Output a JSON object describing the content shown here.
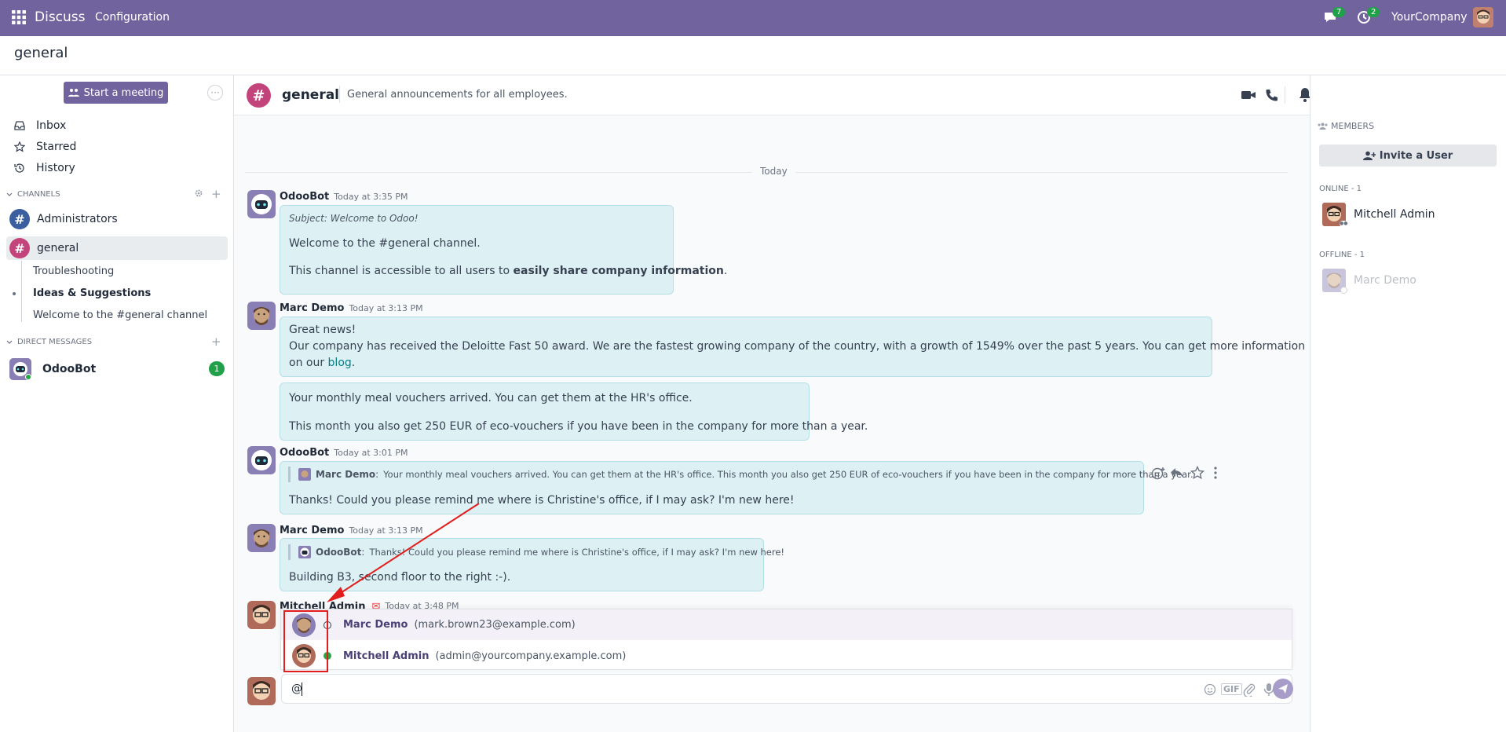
{
  "topbar": {
    "app_name": "Discuss",
    "menu_configuration": "Configuration",
    "messages_count": "7",
    "activities_count": "2",
    "company": "YourCompany"
  },
  "breadcrumb": {
    "title": "general"
  },
  "sidebar": {
    "start_meeting": "Start a meeting",
    "nav": [
      {
        "label": "Inbox",
        "icon": "inbox-icon"
      },
      {
        "label": "Starred",
        "icon": "star-icon"
      },
      {
        "label": "History",
        "icon": "history-icon"
      }
    ],
    "channels_header": "CHANNELS",
    "channels": [
      {
        "label": "Administrators",
        "color": "#3b5ea0"
      },
      {
        "label": "general",
        "color": "#c2447a"
      }
    ],
    "subchannels": [
      "Troubleshooting",
      "Ideas & Suggestions",
      "Welcome to the #general channel"
    ],
    "dm_header": "DIRECT MESSAGES",
    "dm": {
      "label": "OdooBot",
      "unread": "1"
    }
  },
  "channel": {
    "name": "general",
    "description": "General announcements for all employees."
  },
  "thread": {
    "date_separator": "Today",
    "messages": [
      {
        "author": "OdooBot",
        "time": "Today at 3:35 PM",
        "subject": "Subject: Welcome to Odoo!",
        "line1": "Welcome to the #general channel.",
        "line2_pre": "This channel is accessible to all users to ",
        "line2_bold": "easily share company information",
        "line2_post": "."
      },
      {
        "author": "Marc Demo",
        "time": "Today at 3:13 PM",
        "line1": "Great news!",
        "line2": "Our company has received the Deloitte Fast 50 award. We are the fastest growing company of the country, with a growth of 1549% over the past 5 years. You can get more information",
        "line3_pre": "on our ",
        "line3_link": "blog",
        "line3_post": ".",
        "second_line1": "Your monthly meal vouchers arrived. You can get them at the HR's office.",
        "second_line2": "This month you also get 250 EUR of eco-vouchers if you have been in the company for more than a year."
      },
      {
        "author": "OdooBot",
        "time": "Today at 3:01 PM",
        "quote_author": "Marc Demo",
        "quote_text": "Your monthly meal vouchers arrived. You can get them at the HR's office. This month you also get 250 EUR of eco-vouchers if you have been in the company for more than a year.",
        "text": "Thanks! Could you please remind me where is Christine's office, if I may ask? I'm new here!"
      },
      {
        "author": "Marc Demo",
        "time": "Today at 3:13 PM",
        "quote_author": "OdooBot",
        "quote_text": "Thanks! Could you please remind me where is Christine's office, if I may ask? I'm new here!",
        "text": "Building B3, second floor to the right :-)."
      },
      {
        "author": "Mitchell Admin",
        "time": "Today at 3:48 PM"
      }
    ]
  },
  "mention_dropdown": {
    "options": [
      {
        "name": "Marc Demo",
        "email": "(mark.brown23@example.com)",
        "status": "offline"
      },
      {
        "name": "Mitchell Admin",
        "email": "(admin@yourcompany.example.com)",
        "status": "online"
      }
    ]
  },
  "composer": {
    "value": "@",
    "gif_label": "GIF"
  },
  "members_panel": {
    "header": "MEMBERS",
    "invite": "Invite a User",
    "online_header": "ONLINE - 1",
    "online_member": "Mitchell Admin",
    "offline_header": "OFFLINE - 1",
    "offline_member": "Marc Demo"
  },
  "colors": {
    "brand": "#71639e",
    "accent_red": "#e11d1d",
    "bubble": "#ddf1f4",
    "online": "#28a745",
    "badge": "#21a04a"
  }
}
